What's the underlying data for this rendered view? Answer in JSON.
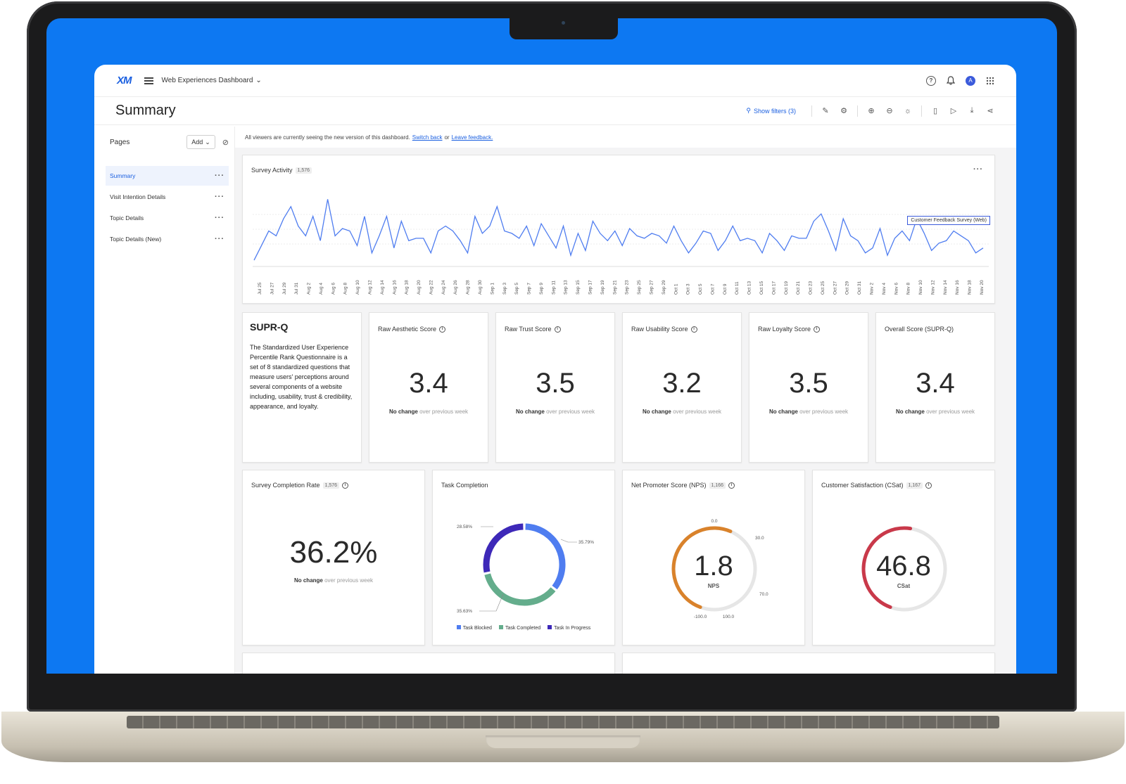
{
  "app": {
    "logo": "XM",
    "dashboard_name": "Web Experiences Dashboard",
    "page_title": "Summary",
    "show_filters": "Show filters (3)",
    "avatar_initial": "A"
  },
  "sidebar": {
    "pages_label": "Pages",
    "add_label": "Add",
    "items": [
      {
        "label": "Summary",
        "active": true
      },
      {
        "label": "Visit Intention Details"
      },
      {
        "label": "Topic Details"
      },
      {
        "label": "Topic Details (New)"
      }
    ]
  },
  "notice": {
    "text": "All viewers are currently seeing the new version of this dashboard.",
    "switch_back": "Switch back",
    "or": "or",
    "leave_feedback": "Leave feedback."
  },
  "survey_activity": {
    "title": "Survey Activity",
    "count": "1,576",
    "legend": "Customer Feedback Survey (Web)"
  },
  "chart_data": [
    {
      "type": "line",
      "title": "Survey Activity",
      "series": [
        {
          "name": "Customer Feedback Survey (Web)",
          "color": "#4f7df0"
        }
      ],
      "x": [
        "Jul 25",
        "Jul 27",
        "Jul 29",
        "Jul 31",
        "Aug 2",
        "Aug 4",
        "Aug 6",
        "Aug 8",
        "Aug 10",
        "Aug 12",
        "Aug 14",
        "Aug 16",
        "Aug 18",
        "Aug 20",
        "Aug 22",
        "Aug 24",
        "Aug 26",
        "Aug 28",
        "Aug 30",
        "Sep 1",
        "Sep 3",
        "Sep 5",
        "Sep 7",
        "Sep 9",
        "Sep 11",
        "Sep 13",
        "Sep 15",
        "Sep 17",
        "Sep 19",
        "Sep 21",
        "Sep 23",
        "Sep 25",
        "Sep 27",
        "Sep 29",
        "Oct 1",
        "Oct 3",
        "Oct 5",
        "Oct 7",
        "Oct 9",
        "Oct 11",
        "Oct 13",
        "Oct 15",
        "Oct 17",
        "Oct 19",
        "Oct 21",
        "Oct 23",
        "Oct 25",
        "Oct 27",
        "Oct 29",
        "Oct 31",
        "Nov 2",
        "Nov 4",
        "Nov 6",
        "Nov 8",
        "Nov 10",
        "Nov 12",
        "Nov 14",
        "Nov 16",
        "Nov 18",
        "Nov 20"
      ],
      "values": [
        2,
        8,
        14,
        12,
        19,
        24,
        16,
        12,
        20,
        10,
        27,
        12,
        15,
        14,
        8,
        20,
        5,
        12,
        20,
        7,
        18,
        10,
        11,
        11,
        5,
        14,
        16,
        14,
        10,
        5,
        20,
        13,
        16,
        24,
        14,
        13,
        11,
        16,
        8,
        17,
        12,
        7,
        16,
        4,
        13,
        6,
        18,
        13,
        10,
        14,
        8,
        15,
        12,
        11,
        13,
        12,
        9,
        16,
        10,
        5,
        9,
        14,
        13,
        6,
        10,
        16,
        10,
        11,
        10,
        5,
        13,
        10,
        6,
        12,
        11,
        11,
        18,
        21,
        14,
        6,
        19,
        12,
        10,
        5,
        7,
        15,
        4,
        11,
        14,
        10,
        19,
        13,
        6,
        9,
        10,
        14,
        12,
        10,
        5,
        7
      ]
    },
    {
      "type": "pie",
      "title": "Task Completion",
      "categories": [
        "Task Blocked",
        "Task Completed",
        "Task In Progress"
      ],
      "values": [
        35.79,
        35.63,
        28.58
      ],
      "colors": [
        "#4f7df0",
        "#64ad8c",
        "#3d28b8"
      ]
    }
  ],
  "supr_q": {
    "title": "SUPR-Q",
    "description": "The Standardized User Experience Percentile Rank Questionnaire is a set of 8 standardized questions that measure users' perceptions around several components of a website including, usability, trust & credibility, appearance, and loyalty."
  },
  "kpis": [
    {
      "title": "Raw Aesthetic Score",
      "value": "3.4",
      "change": "No change",
      "period": "over previous week"
    },
    {
      "title": "Raw Trust Score",
      "value": "3.5",
      "change": "No change",
      "period": "over previous week"
    },
    {
      "title": "Raw Usability Score",
      "value": "3.2",
      "change": "No change",
      "period": "over previous week"
    },
    {
      "title": "Raw Loyalty Score",
      "value": "3.5",
      "change": "No change",
      "period": "over previous week"
    },
    {
      "title": "Overall Score (SUPR-Q)",
      "value": "3.4",
      "change": "No change",
      "period": "over previous week"
    }
  ],
  "completion_rate": {
    "title": "Survey Completion Rate",
    "count": "1,576",
    "value": "36.2%",
    "change": "No change",
    "period": "over previous week"
  },
  "task_completion": {
    "title": "Task Completion",
    "labels": [
      "35.79%",
      "35.63%",
      "28.58%"
    ],
    "legend": [
      "Task Blocked",
      "Task Completed",
      "Task In Progress"
    ]
  },
  "nps": {
    "title": "Net Promoter Score (NPS)",
    "count": "1,166",
    "value": "1.8",
    "unit": "NPS",
    "min": "-100.0",
    "max": "100.0",
    "mark_top": "0.0",
    "mark_30": "30.0",
    "mark_70": "70.0",
    "color": "#d9822b",
    "fraction": 0.509
  },
  "csat": {
    "title": "Customer Satisfaction (CSat)",
    "count": "1,167",
    "value": "46.8",
    "unit": "CSat",
    "color": "#c9394a",
    "fraction": 0.468
  }
}
